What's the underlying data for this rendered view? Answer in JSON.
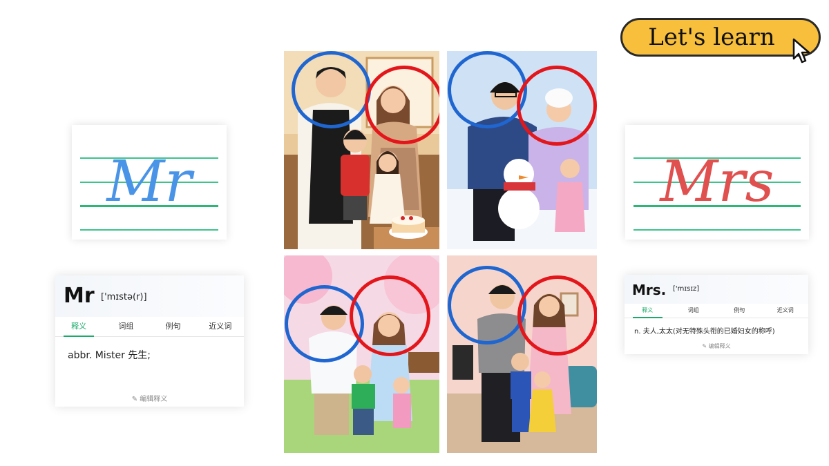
{
  "button": {
    "label": "Let's learn"
  },
  "left_write": {
    "word": "Mr",
    "color": "#4a94e8"
  },
  "right_write": {
    "word": "Mrs",
    "color": "#e0504f"
  },
  "dict_left": {
    "word": "Mr",
    "phonetic": "['mɪstə(r)]",
    "tabs": [
      "释义",
      "词组",
      "例句",
      "近义词"
    ],
    "definition": "abbr.  Mister 先生;",
    "edit": "编辑释义"
  },
  "dict_right": {
    "word": "Mrs.",
    "phonetic": "['mɪsɪz]",
    "tabs": [
      "释义",
      "词组",
      "例句",
      "近义词"
    ],
    "definition": "n.  夫人,太太(对无特殊头衔的已婚妇女的称呼)",
    "edit": "编辑释义"
  },
  "photos": [
    {
      "scene": "kitchen-family"
    },
    {
      "scene": "snow-family"
    },
    {
      "scene": "park-family"
    },
    {
      "scene": "living-room-family"
    }
  ],
  "colors": {
    "father_circle": "#1f66d1",
    "mother_circle": "#e3161b",
    "accent": "#1aaa6a"
  }
}
